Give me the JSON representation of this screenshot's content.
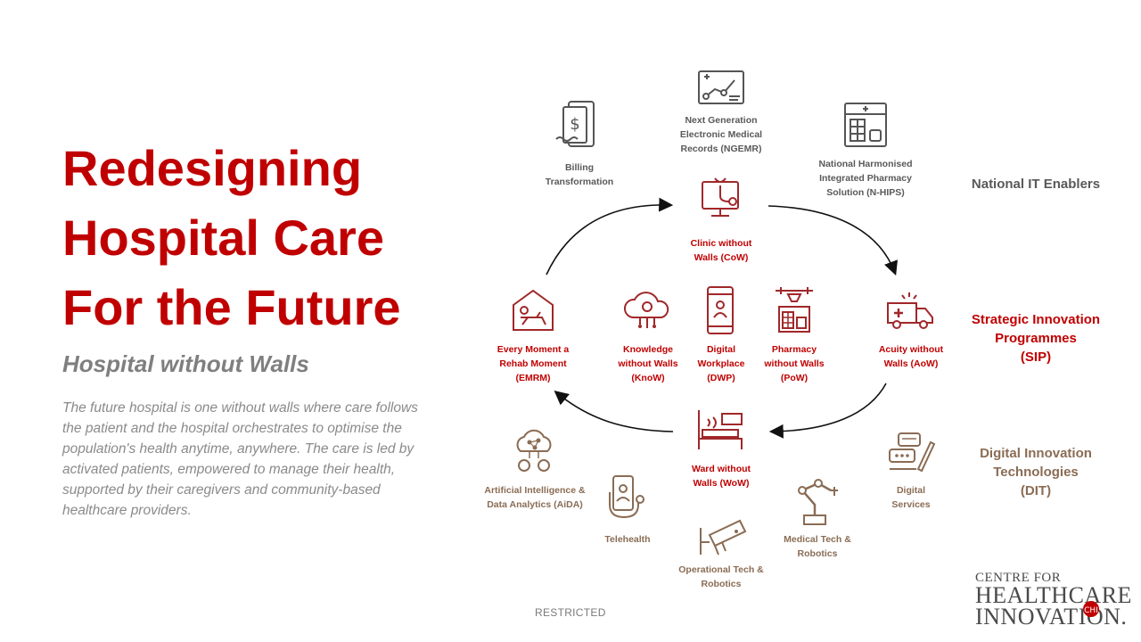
{
  "title_lines": [
    "Redesigning",
    "Hospital Care",
    "For the Future"
  ],
  "subtitle": "Hospital without Walls",
  "description": "The future hospital is one without walls where care follows the patient and the hospital orchestrates to optimise the population's health anytime, anywhere. The care is led by activated patients, empowered to manage their health, supported by their caregivers and community-based healthcare providers.",
  "categories": {
    "national_it": "National IT Enablers",
    "sip_lines": [
      "Strategic Innovation",
      "Programmes",
      "(SIP)"
    ],
    "dit_lines": [
      "Digital Innovation",
      "Technologies",
      "(DIT)"
    ]
  },
  "national_it_enablers": [
    {
      "lines": [
        "Billing",
        "Transformation"
      ],
      "icon": "billing-icon"
    },
    {
      "lines": [
        "Next Generation",
        "Electronic Medical",
        "Records (NGEMR)"
      ],
      "icon": "emr-icon"
    },
    {
      "lines": [
        "National Harmonised",
        "Integrated Pharmacy",
        "Solution (N-HIPS)"
      ],
      "icon": "pharmacy-solution-icon"
    }
  ],
  "strategic_programmes": [
    {
      "lines": [
        "Clinic without",
        "Walls (CoW)"
      ],
      "icon": "clinic-icon"
    },
    {
      "lines": [
        "Acuity without",
        "Walls (AoW)"
      ],
      "icon": "ambulance-icon"
    },
    {
      "lines": [
        "Ward without",
        "Walls (WoW)"
      ],
      "icon": "ward-bed-icon"
    },
    {
      "lines": [
        "Every Moment a",
        "Rehab Moment",
        "(EMRM)"
      ],
      "icon": "rehab-icon"
    },
    {
      "lines": [
        "Knowledge",
        "without Walls",
        "(KnoW)"
      ],
      "icon": "knowledge-cloud-icon"
    },
    {
      "lines": [
        "Digital",
        "Workplace",
        "(DWP)"
      ],
      "icon": "digital-workplace-icon"
    },
    {
      "lines": [
        "Pharmacy",
        "without Walls",
        "(PoW)"
      ],
      "icon": "pharmacy-drone-icon"
    }
  ],
  "digital_technologies": [
    {
      "lines": [
        "Artificial Intelligence &",
        "Data Analytics (AiDA)"
      ],
      "icon": "ai-network-icon"
    },
    {
      "lines": [
        "Telehealth"
      ],
      "icon": "telehealth-icon"
    },
    {
      "lines": [
        "Operational Tech &",
        "Robotics"
      ],
      "icon": "camera-icon"
    },
    {
      "lines": [
        "Medical Tech &",
        "Robotics"
      ],
      "icon": "robot-arm-icon"
    },
    {
      "lines": [
        "Digital",
        "Services"
      ],
      "icon": "digital-services-icon"
    }
  ],
  "footer": {
    "restricted": "RESTRICTED"
  },
  "logo": {
    "line1": "CENTRE FOR",
    "line2": "HEALTHCARE",
    "line3": "INNOVATION."
  },
  "colors": {
    "red": "#c00000",
    "brown": "#8a6c54",
    "gray": "#595959"
  }
}
